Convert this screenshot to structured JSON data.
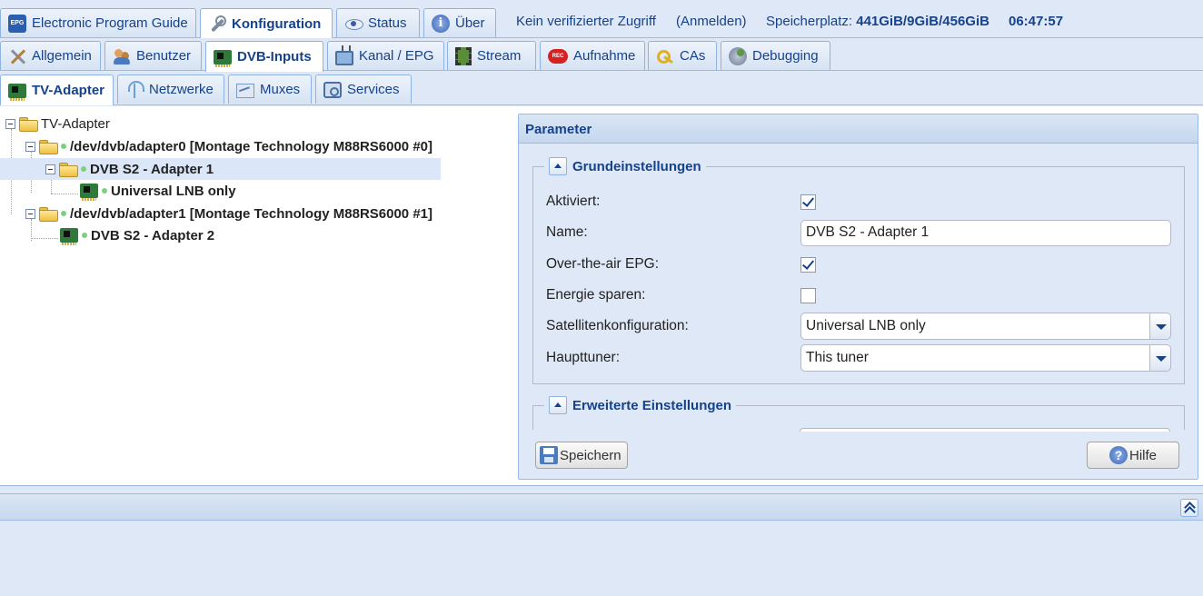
{
  "top_tabs": [
    {
      "label": "Electronic Program Guide",
      "icon": "epg-icon"
    },
    {
      "label": "Konfiguration",
      "icon": "wrench-icon",
      "active": true
    },
    {
      "label": "Status",
      "icon": "eye-icon"
    },
    {
      "label": "Über",
      "icon": "info-icon"
    }
  ],
  "header_info": {
    "access": "Kein verifizierter Zugriff",
    "login": "(Anmelden)",
    "storage_label": "Speicherplatz:",
    "storage_value": "441GiB/9GiB/456GiB",
    "time": "06:47:57"
  },
  "config_tabs": [
    {
      "label": "Allgemein",
      "icon": "tools-icon"
    },
    {
      "label": "Benutzer",
      "icon": "users-icon"
    },
    {
      "label": "DVB-Inputs",
      "icon": "dvb-card-icon",
      "active": true
    },
    {
      "label": "Kanal / EPG",
      "icon": "tv-icon"
    },
    {
      "label": "Stream",
      "icon": "film-icon"
    },
    {
      "label": "Aufnahme",
      "icon": "rec-icon",
      "icon_text": "REC"
    },
    {
      "label": "CAs",
      "icon": "key-icon"
    },
    {
      "label": "Debugging",
      "icon": "bug-icon"
    }
  ],
  "dvb_tabs": [
    {
      "label": "TV-Adapter",
      "icon": "dvb-card-icon",
      "active": true
    },
    {
      "label": "Netzwerke",
      "icon": "antenna-icon"
    },
    {
      "label": "Muxes",
      "icon": "mux-icon"
    },
    {
      "label": "Services",
      "icon": "services-icon"
    }
  ],
  "tree": {
    "root": "TV-Adapter",
    "adapter0": "/dev/dvb/adapter0 [Montage Technology M88RS6000 #0]",
    "adapter0_frontend": "DVB S2 - Adapter 1",
    "adapter0_lnb": "Universal LNB only",
    "adapter1": "/dev/dvb/adapter1 [Montage Technology M88RS6000 #1]",
    "adapter1_frontend": "DVB S2 - Adapter 2"
  },
  "panel": {
    "title": "Parameter",
    "basic_section": "Grundeinstellungen",
    "advanced_section": "Erweiterte Einstellungen",
    "fields": {
      "enabled_label": "Aktiviert:",
      "enabled": true,
      "name_label": "Name:",
      "name_value": "DVB S2 - Adapter 1",
      "epg_label": "Over-the-air EPG:",
      "epg": true,
      "power_label": "Energie sparen:",
      "power": false,
      "sat_label": "Satellitenkonfiguration:",
      "sat_value": "Universal LNB only",
      "master_label": "Haupttuner:",
      "master_value": "This tuner"
    },
    "save_button": "Speichern",
    "help_button": "Hilfe"
  },
  "icon_text": {
    "epg": "EPG",
    "info": "i",
    "help": "?"
  }
}
